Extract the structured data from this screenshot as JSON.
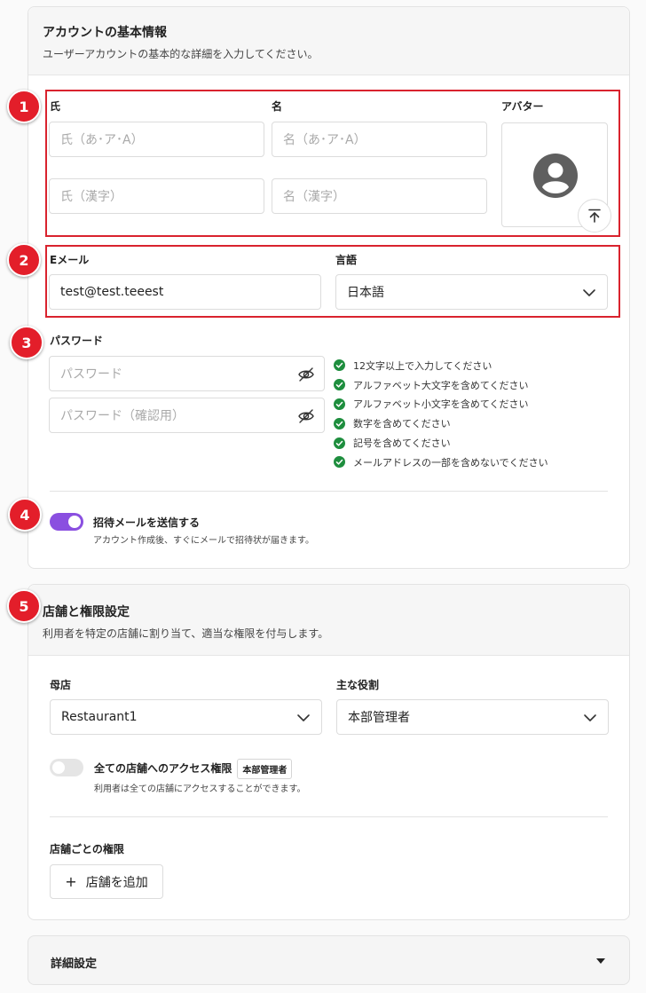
{
  "basic": {
    "title": "アカウントの基本情報",
    "desc": "ユーザーアカウントの基本的な詳細を入力してください。",
    "last_name_label": "氏",
    "first_name_label": "名",
    "avatar_label": "アバター",
    "last_kana_ph": "氏（あ･ア･A）",
    "first_kana_ph": "名（あ･ア･A）",
    "last_kanji_ph": "氏（漢字）",
    "first_kanji_ph": "名（漢字）",
    "email_label": "Eメール",
    "email_value": "test@test.teeest",
    "lang_label": "言語",
    "lang_value": "日本語",
    "password_label": "パスワード",
    "password_ph": "パスワード",
    "password_confirm_ph": "パスワード（確認用）",
    "rules": [
      "12文字以上で入力してください",
      "アルファベット大文字を含めてください",
      "アルファベット小文字を含めてください",
      "数字を含めてください",
      "記号を含めてください",
      "メールアドレスの一部を含めないでください"
    ],
    "invite_title": "招待メールを送信する",
    "invite_desc": "アカウント作成後、すぐにメールで招待状が届きます。",
    "invite_on": true
  },
  "store": {
    "title": "店舗と権限設定",
    "desc": "利用者を特定の店舗に割り当て、適当な権限を付与します。",
    "parent_label": "母店",
    "parent_value": "Restaurant1",
    "role_label": "主な役割",
    "role_value": "本部管理者",
    "all_access_title": "全ての店舗へのアクセス権限",
    "all_access_badge": "本部管理者",
    "all_access_desc": "利用者は全ての店舗にアクセスすることができます。",
    "all_access_on": false,
    "per_store_label": "店舗ごとの権限",
    "add_store_label": "店舗を追加"
  },
  "advanced": {
    "title": "詳細設定"
  },
  "steps": [
    "1",
    "2",
    "3",
    "4",
    "5"
  ],
  "colors": {
    "accent": "#8a4fe0",
    "step": "#e31e2a",
    "check": "#1e8e3e"
  }
}
